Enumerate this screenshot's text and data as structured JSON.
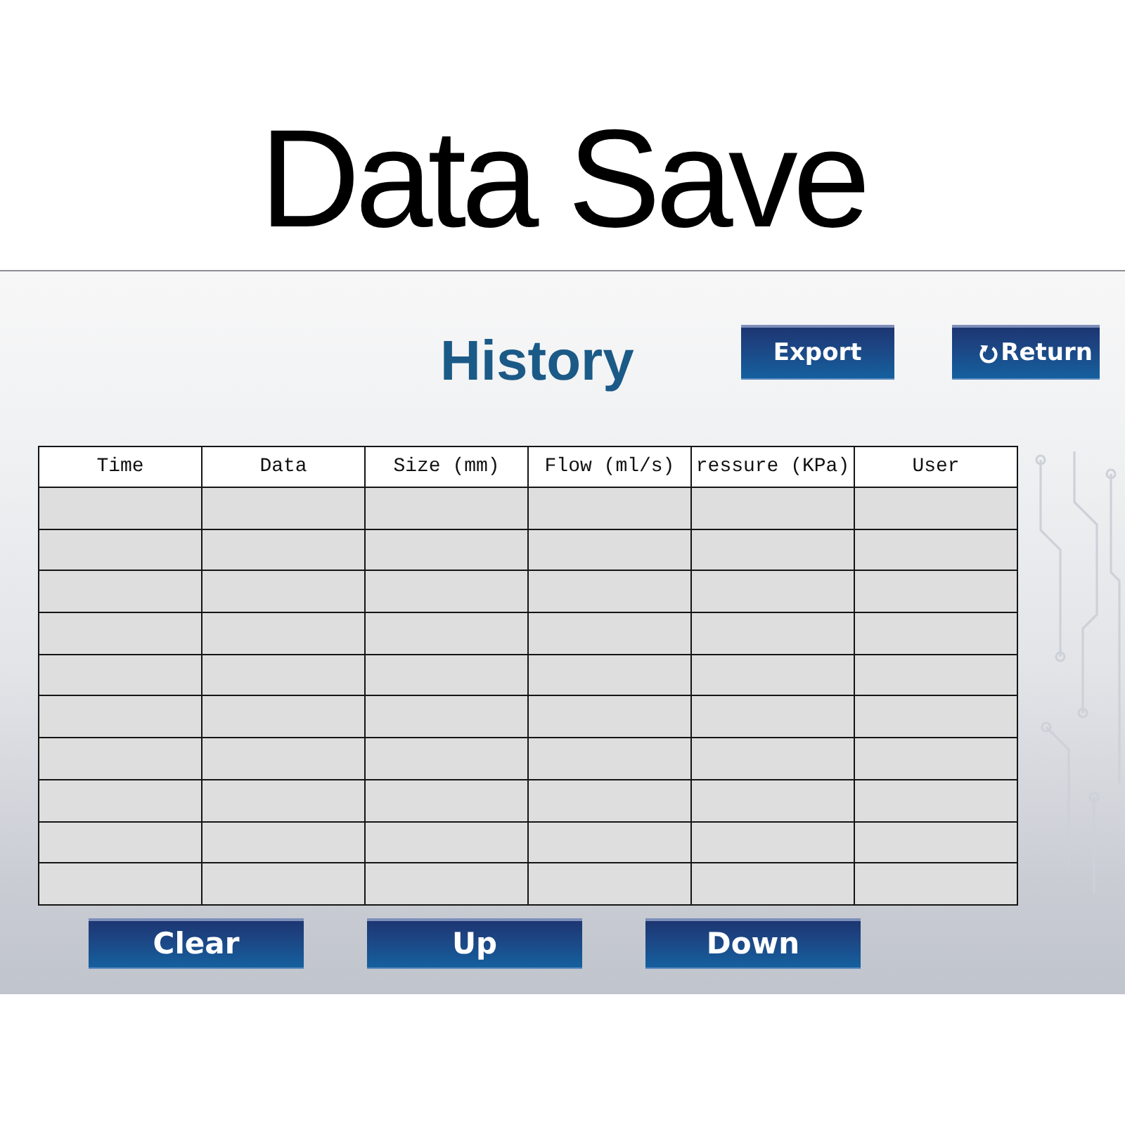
{
  "header": {
    "title": "Data Save"
  },
  "panel": {
    "title": "History",
    "top_buttons": [
      {
        "kind": "export",
        "label": "Export"
      },
      {
        "kind": "return",
        "label": "Return"
      }
    ],
    "table": {
      "columns": [
        "Time",
        "Data",
        "Size (mm)",
        "Flow (ml/s)",
        "ressure (KPa)",
        "User"
      ],
      "rows": [
        {
          "selected": false
        },
        {
          "selected": false
        },
        {
          "selected": false
        },
        {
          "selected": false
        },
        {
          "selected": false
        },
        {
          "selected": false
        },
        {
          "selected": false
        },
        {
          "selected": false
        },
        {
          "selected": false
        },
        {
          "selected": false
        }
      ]
    },
    "bottom_buttons": {
      "clear": {
        "label": "Clear"
      },
      "up": {
        "label": "Up"
      },
      "down": {
        "label": "Down"
      }
    }
  }
}
